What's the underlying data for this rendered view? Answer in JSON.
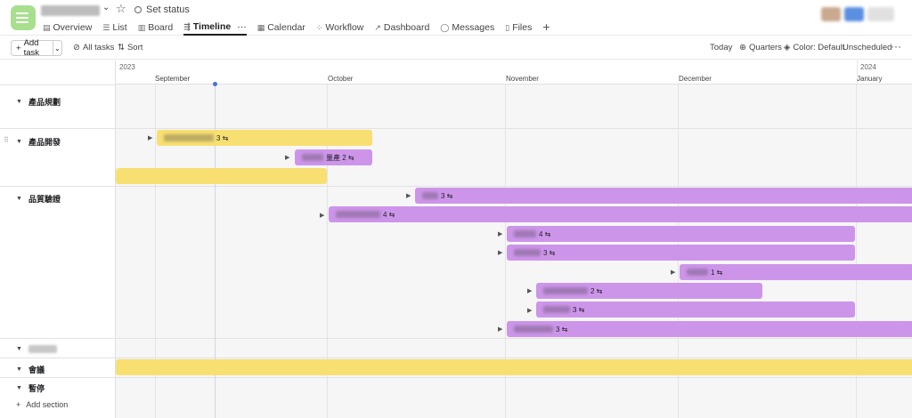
{
  "header": {
    "set_status": "Set status",
    "tabs": [
      {
        "icon": "▤",
        "label": "Overview"
      },
      {
        "icon": "☰",
        "label": "List"
      },
      {
        "icon": "▥",
        "label": "Board"
      },
      {
        "icon": "⇶",
        "label": "Timeline",
        "extra": "···"
      },
      {
        "icon": "▦",
        "label": "Calendar"
      },
      {
        "icon": "⁘",
        "label": "Workflow"
      },
      {
        "icon": "↗",
        "label": "Dashboard"
      },
      {
        "icon": "◯",
        "label": "Messages"
      },
      {
        "icon": "▯",
        "label": "Files"
      }
    ],
    "avatar_colors": [
      "#c9a98f",
      "#5b8fe0",
      "#e6e6e6"
    ]
  },
  "toolbar": {
    "add_task": "Add task",
    "all_tasks": "All tasks",
    "sort": "Sort",
    "today": "Today",
    "quarters": "Quarters",
    "color": "Color: Default",
    "unscheduled": "Unscheduled",
    "more": "···"
  },
  "timeline": {
    "years": [
      "2023",
      "2024"
    ],
    "months": [
      "September",
      "October",
      "November",
      "December",
      "January"
    ],
    "sections": [
      {
        "label": "產品規劃"
      },
      {
        "label": "產品開發"
      },
      {
        "label": "品質驗證"
      },
      {
        "label": ""
      },
      {
        "label": "會議"
      },
      {
        "label": "暫停"
      }
    ],
    "add_section": "Add section",
    "bars": [
      {
        "suffix": "3 ⇆",
        "color": "yellow"
      },
      {
        "suffix": "量產 2 ⇆",
        "color": "purple"
      },
      {
        "suffix": "",
        "color": "yellow"
      },
      {
        "suffix": "3 ⇆",
        "color": "purple"
      },
      {
        "suffix": "4 ⇆",
        "color": "purple"
      },
      {
        "suffix": "4 ⇆",
        "color": "purple"
      },
      {
        "suffix": "3 ⇆",
        "color": "purple"
      },
      {
        "suffix": "1 ⇆",
        "color": "purple"
      },
      {
        "suffix": "2 ⇆",
        "color": "purple"
      },
      {
        "suffix": "3 ⇆",
        "color": "purple"
      },
      {
        "suffix": "3 ⇆",
        "color": "purple"
      },
      {
        "suffix": "",
        "color": "yellow"
      }
    ]
  }
}
